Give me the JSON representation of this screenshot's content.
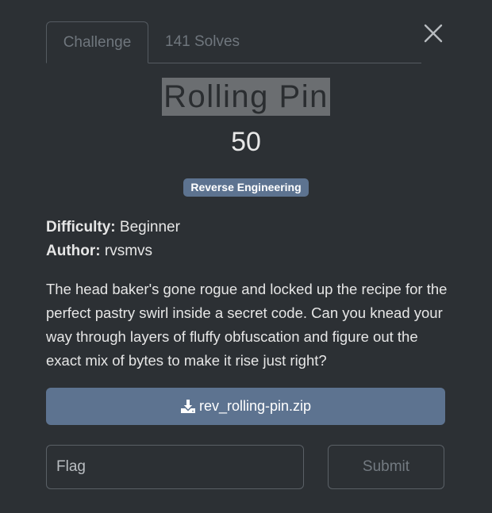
{
  "tabs": [
    {
      "label": "Challenge"
    },
    {
      "label": "141 Solves"
    }
  ],
  "challenge": {
    "title": "Rolling Pin",
    "points": "50",
    "category": "Reverse Engineering",
    "difficulty_label": "Difficulty:",
    "difficulty_value": "Beginner",
    "author_label": "Author:",
    "author_value": "rvsmvs",
    "description": "The head baker's gone rogue and locked up the recipe for the perfect pastry swirl inside a secret code. Can you knead your way through layers of fluffy obfuscation and figure out the exact mix of bytes to make it rise just right?"
  },
  "download": {
    "filename": "rev_rolling-pin.zip",
    "icon": "download-icon"
  },
  "submission": {
    "placeholder": "Flag",
    "submit_label": "Submit"
  },
  "colors": {
    "background": "#2c3034",
    "accent": "#5d7390"
  }
}
